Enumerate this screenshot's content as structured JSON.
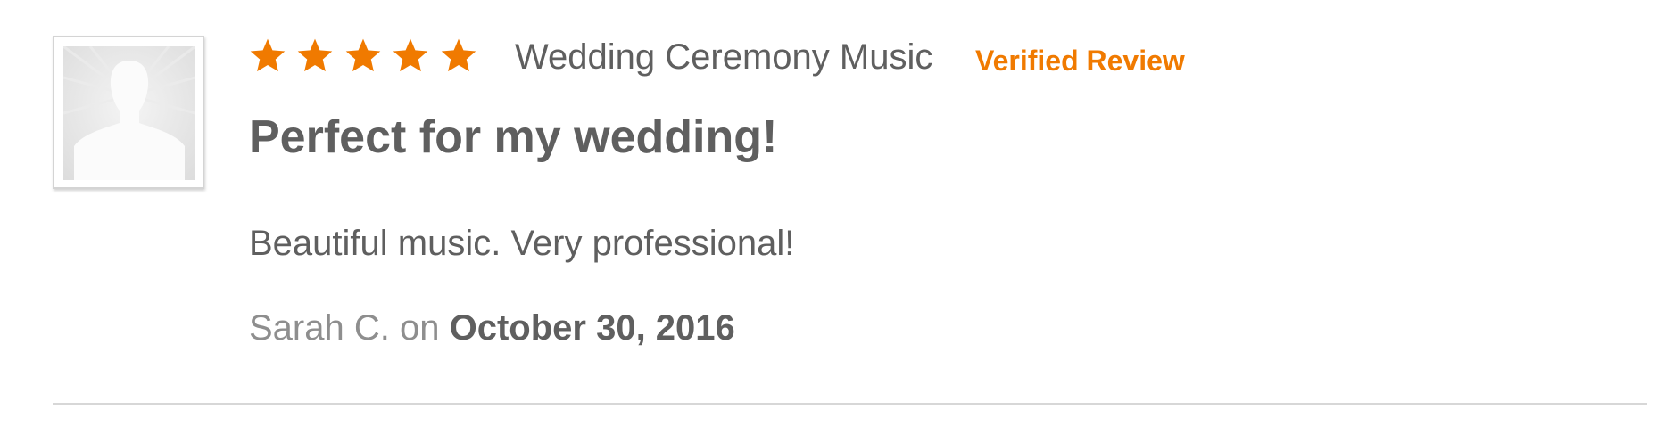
{
  "review": {
    "rating": 5,
    "rating_max": 5,
    "service": "Wedding Ceremony Music",
    "verified_label": "Verified Review",
    "title": "Perfect for my wedding!",
    "body": "Beautiful music. Very professional!",
    "author": "Sarah C.",
    "on_text": "on",
    "date": "October 30, 2016"
  },
  "icons": {
    "avatar": "default-user-silhouette-icon",
    "star": "star-filled-icon"
  },
  "colors": {
    "star": "#f07a00",
    "verified": "#f07a00",
    "text": "#5f5f5f",
    "muted_text": "#8e8e8e",
    "divider": "#d7d7d7"
  }
}
